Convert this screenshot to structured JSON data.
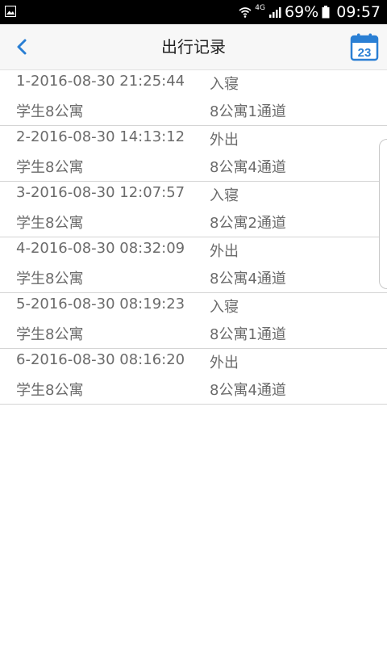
{
  "status_bar": {
    "network": "4G",
    "battery": "69%",
    "time": "09:57"
  },
  "app_bar": {
    "title": "出行记录",
    "calendar_day": "23"
  },
  "records": [
    {
      "time": "1-2016-08-30 21:25:44",
      "action": "入寝",
      "building": "学生8公寓",
      "channel": "8公寓1通道"
    },
    {
      "time": "2-2016-08-30 14:13:12",
      "action": "外出",
      "building": "学生8公寓",
      "channel": "8公寓4通道"
    },
    {
      "time": "3-2016-08-30 12:07:57",
      "action": "入寝",
      "building": "学生8公寓",
      "channel": "8公寓2通道"
    },
    {
      "time": "4-2016-08-30 08:32:09",
      "action": "外出",
      "building": "学生8公寓",
      "channel": "8公寓4通道"
    },
    {
      "time": "5-2016-08-30 08:19:23",
      "action": "入寝",
      "building": "学生8公寓",
      "channel": "8公寓1通道"
    },
    {
      "time": "6-2016-08-30 08:16:20",
      "action": "外出",
      "building": "学生8公寓",
      "channel": "8公寓4通道"
    }
  ],
  "colors": {
    "accent": "#2a7fd4",
    "text_secondary": "#6b6b6b"
  }
}
